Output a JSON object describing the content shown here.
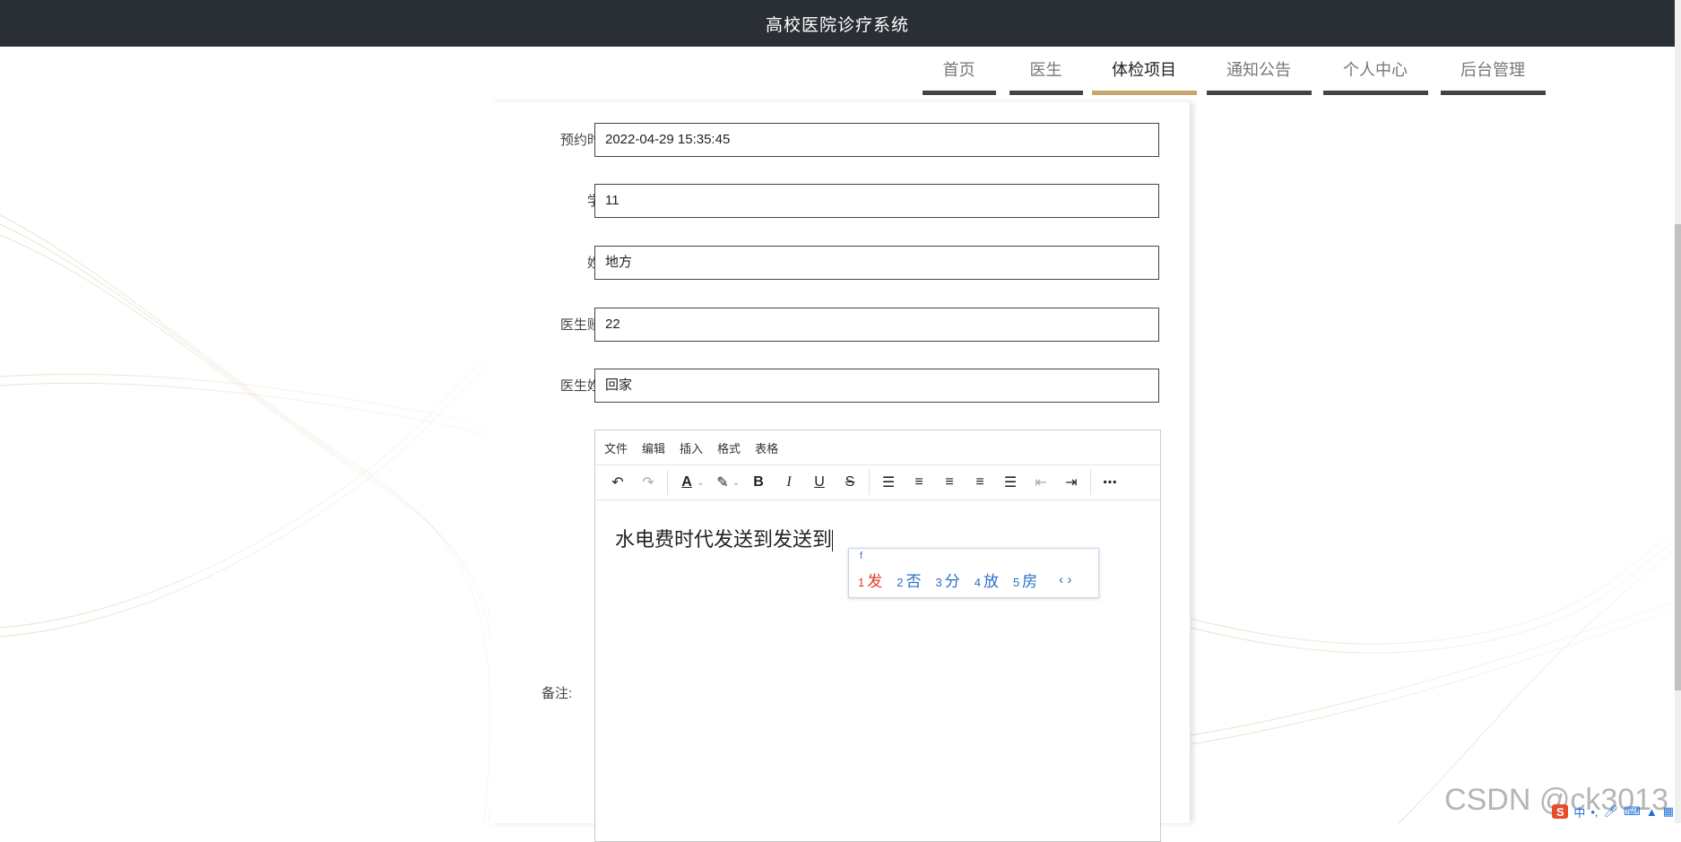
{
  "app": {
    "title": "高校医院诊疗系统"
  },
  "nav": {
    "items": [
      {
        "label": "首页"
      },
      {
        "label": "医生"
      },
      {
        "label": "体检项目"
      },
      {
        "label": "通知公告"
      },
      {
        "label": "个人中心"
      },
      {
        "label": "后台管理"
      }
    ],
    "active": "体检项目"
  },
  "form": {
    "appointment_time": {
      "label": "预约时间:",
      "value": "2022-04-29 15:35:45"
    },
    "student_id": {
      "label": "学号:",
      "value": "11"
    },
    "name": {
      "label": "姓名:",
      "value": "地方"
    },
    "doctor_account": {
      "label": "医生账号:",
      "value": "22"
    },
    "doctor_name": {
      "label": "医生姓名:",
      "value": "回家"
    },
    "remark": {
      "label": "备注:"
    }
  },
  "editor": {
    "menu": [
      "文件",
      "编辑",
      "插入",
      "格式",
      "表格"
    ],
    "content": "水电费时代发送到发送到"
  },
  "ime": {
    "composition": "f",
    "candidates": [
      {
        "num": "1",
        "text": "发"
      },
      {
        "num": "2",
        "text": "否"
      },
      {
        "num": "3",
        "text": "分"
      },
      {
        "num": "4",
        "text": "放"
      },
      {
        "num": "5",
        "text": "房"
      }
    ]
  },
  "watermark": "CSDN @ck3013",
  "tray": {
    "logo": "S",
    "lang": "中"
  },
  "colors": {
    "topbar": "#2a2f36",
    "active_tab": "#c8a66b",
    "tab_underline": "#444444"
  }
}
